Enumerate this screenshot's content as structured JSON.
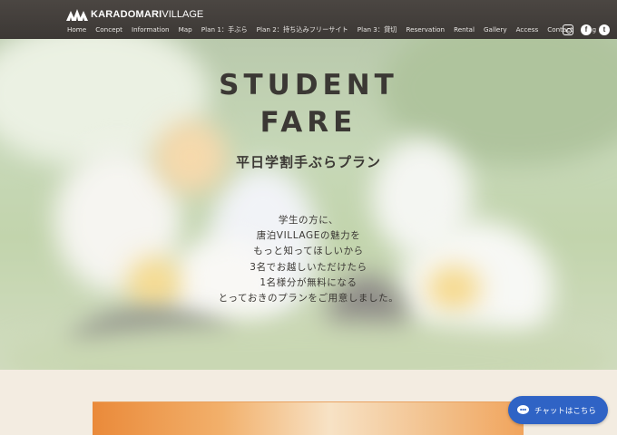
{
  "header": {
    "logo_bold": "KARADOMARI",
    "logo_light": "VILLAGE",
    "nav": [
      "Home",
      "Concept",
      "Information",
      "Map",
      "Plan 1：手ぶら",
      "Plan 2：持ち込みフリーサイト",
      "Plan 3：貸切",
      "Reservation",
      "Rental",
      "Gallery",
      "Access",
      "Contact",
      "Blog"
    ],
    "social": [
      {
        "name": "instagram-icon",
        "glyph": ""
      },
      {
        "name": "facebook-icon",
        "glyph": "f"
      },
      {
        "name": "twitter-icon",
        "glyph": "t"
      }
    ]
  },
  "hero": {
    "title_line1": "STUDENT",
    "title_line2": "FARE",
    "subtitle": "平日学割手ぶらプラン",
    "body": [
      "学生の方に、",
      "唐泊VILLAGEの魅力を",
      "もっと知ってほしいから",
      "3名でお越しいただけたら",
      "1名様分が無料になる",
      "とっておきのプランをご用意しました。"
    ]
  },
  "chat": {
    "label": "チャットはこちら"
  },
  "colors": {
    "header_bg": "#3c3835",
    "page_bg": "#f3ece1",
    "chat_bg": "#2f63c5",
    "title_text": "#3b3834",
    "card_accent": "#ea8a3a"
  }
}
